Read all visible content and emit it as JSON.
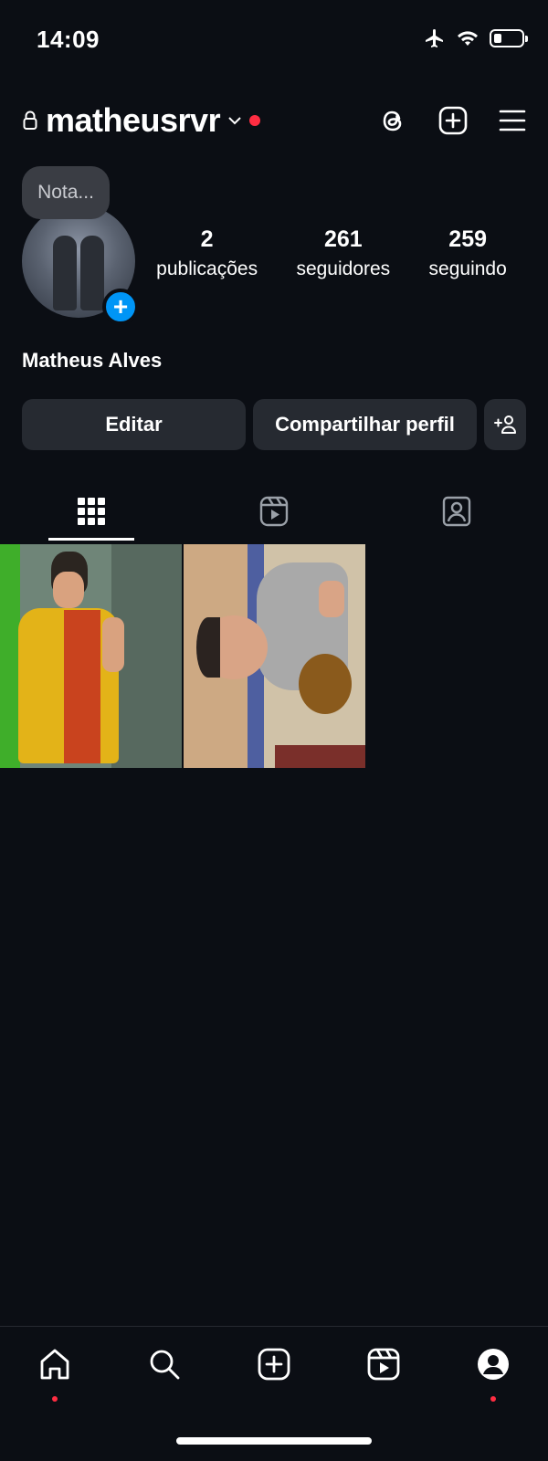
{
  "status_bar": {
    "time": "14:09"
  },
  "header": {
    "username": "matheusrvr",
    "icons": [
      "lock-icon",
      "chevron-down-icon",
      "threads-icon",
      "create-icon",
      "menu-icon"
    ]
  },
  "profile": {
    "note": "Nota...",
    "full_name": "Matheus Alves",
    "stats": [
      {
        "value": "2",
        "label": "publicações"
      },
      {
        "value": "261",
        "label": "seguidores"
      },
      {
        "value": "259",
        "label": "seguindo"
      }
    ]
  },
  "actions": {
    "edit_label": "Editar",
    "share_label": "Compartilhar perfil",
    "add_person_label": "+ℛ"
  },
  "tabs": [
    "grid-icon",
    "reels-icon",
    "tagged-icon"
  ],
  "posts": [
    {
      "name": "post-mirror-selfie"
    },
    {
      "name": "post-bowling"
    }
  ],
  "bottom_nav": [
    "home-icon",
    "search-icon",
    "create-icon",
    "reels-icon",
    "profile-icon"
  ],
  "colors": {
    "background": "#0b0e14",
    "button": "#262a31",
    "accent": "#0095f6",
    "notification": "#ff2d42"
  }
}
